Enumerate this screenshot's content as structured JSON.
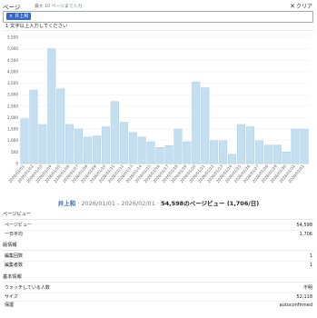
{
  "header": {
    "pages_label": "ページ",
    "max_hint": "最大 10 ページまで入力",
    "clear_label": "クリア",
    "chip_label": "井上和",
    "hint_text": "1 文字以上入力してください"
  },
  "chart_data": {
    "type": "bar",
    "ylim": [
      0,
      5500
    ],
    "y_ticks": [
      0,
      500,
      1000,
      1500,
      2000,
      2500,
      3000,
      3500,
      4000,
      4500,
      5000,
      5500
    ],
    "y_tick_labels": [
      "0",
      "500",
      "1,000",
      "1,500",
      "2,000",
      "2,500",
      "3,000",
      "3,500",
      "4,000",
      "4,500",
      "5,000",
      "5,500"
    ],
    "categories": [
      "2026/01/01",
      "2026/01/02",
      "2026/01/03",
      "2026/01/04",
      "2026/01/05",
      "2026/01/06",
      "2026/01/07",
      "2026/01/08",
      "2026/01/09",
      "2026/01/10",
      "2026/01/11",
      "2026/01/12",
      "2026/01/13",
      "2026/01/14",
      "2026/01/15",
      "2026/01/16",
      "2026/01/17",
      "2026/01/18",
      "2026/01/19",
      "2026/01/20",
      "2026/01/21",
      "2026/01/22",
      "2026/01/23",
      "2026/01/24",
      "2026/01/25",
      "2026/01/26",
      "2026/01/27",
      "2026/01/28",
      "2026/01/29",
      "2026/01/30",
      "2026/01/31",
      "2026/02/01"
    ],
    "x_tick_labels": [
      "2026/01/01",
      "2026/01/02",
      "2026/01/03",
      "2026/01/04",
      "2026/01/05",
      "2026/01/06",
      "2026/01/07",
      "2026/01/08",
      "2026/01/09",
      "2026/01/10",
      "2026/01/11",
      "2026/01/12",
      "2026/01/13",
      "2026/01/14",
      "2026/01/15",
      "2026/01/16",
      "2026/01/17",
      "2026/01/18",
      "2026/01/19",
      "2026/01/20",
      "2026/01/21",
      "2026/01/22",
      "2026/01/23",
      "2026/01/24",
      "2026/01/25",
      "2026/01/26",
      "2026/01/27",
      "2026/01/28",
      "2026/01/29",
      "2026/01/30",
      "2026/01/31",
      "2026/02/01"
    ],
    "values": [
      1950,
      3200,
      1700,
      5000,
      3250,
      1700,
      1500,
      1150,
      1200,
      1600,
      2700,
      1800,
      1350,
      1150,
      950,
      700,
      780,
      1500,
      950,
      3550,
      3300,
      1000,
      1000,
      400,
      1700,
      1600,
      1000,
      800,
      800,
      500,
      1500,
      1500
    ]
  },
  "summary": {
    "article": "井上和",
    "range": " · 2026/01/01 - 2026/02/01 · ",
    "views": "54,598のページビュー (1,706/日)"
  },
  "pageviews": {
    "title": "ページビュー",
    "rows": [
      {
        "k": "ページビュー",
        "v": "54,598"
      },
      {
        "k": "一日平均",
        "v": "1,706"
      }
    ]
  },
  "revisions": {
    "title": "版情報",
    "rows": [
      {
        "k": "編集回数",
        "v": "1"
      },
      {
        "k": "編集者数",
        "v": "1"
      }
    ]
  },
  "basic": {
    "title": "基本情報",
    "rows": [
      {
        "k": "ウォッチしている人数",
        "v": "不明"
      },
      {
        "k": "サイズ",
        "v": "52,118"
      },
      {
        "k": "保護",
        "v": "autoconfirmed"
      }
    ]
  }
}
